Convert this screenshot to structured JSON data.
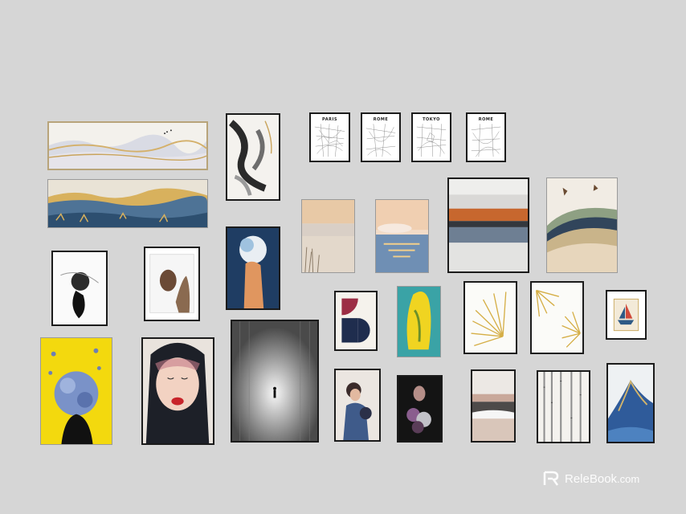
{
  "maps": {
    "paris": "PARIS",
    "rome_1": "ROME",
    "tokyo": "TOKYO",
    "rome_2": "ROME"
  },
  "watermark": {
    "brand": "ReleBook",
    "suffix": ".com"
  }
}
